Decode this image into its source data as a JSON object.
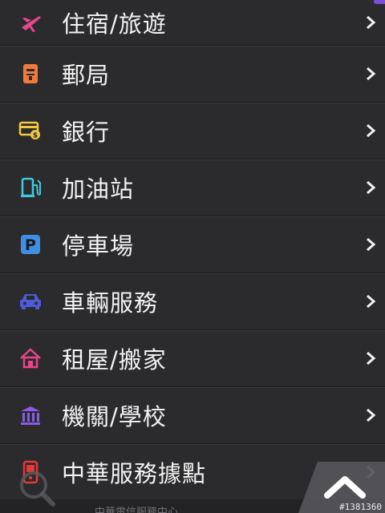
{
  "menu": {
    "items": [
      {
        "label": "住宿/旅遊",
        "icon": "airplane-icon"
      },
      {
        "label": "郵局",
        "icon": "postbox-icon"
      },
      {
        "label": "銀行",
        "icon": "bank-card-icon"
      },
      {
        "label": "加油站",
        "icon": "fuel-pump-icon"
      },
      {
        "label": "停車場",
        "icon": "parking-icon"
      },
      {
        "label": "車輛服務",
        "icon": "car-icon"
      },
      {
        "label": "租屋/搬家",
        "icon": "house-icon"
      },
      {
        "label": "機關/學校",
        "icon": "government-building-icon"
      },
      {
        "label": "中華服務據點",
        "icon": "mobile-phone-icon"
      }
    ]
  },
  "footer": {
    "partial_text": "中華電信服務中心",
    "watermark": "#1381360"
  },
  "colors": {
    "background": "#2b2b2d",
    "text": "#f2f2f2",
    "accent": "#7a4fd6"
  }
}
